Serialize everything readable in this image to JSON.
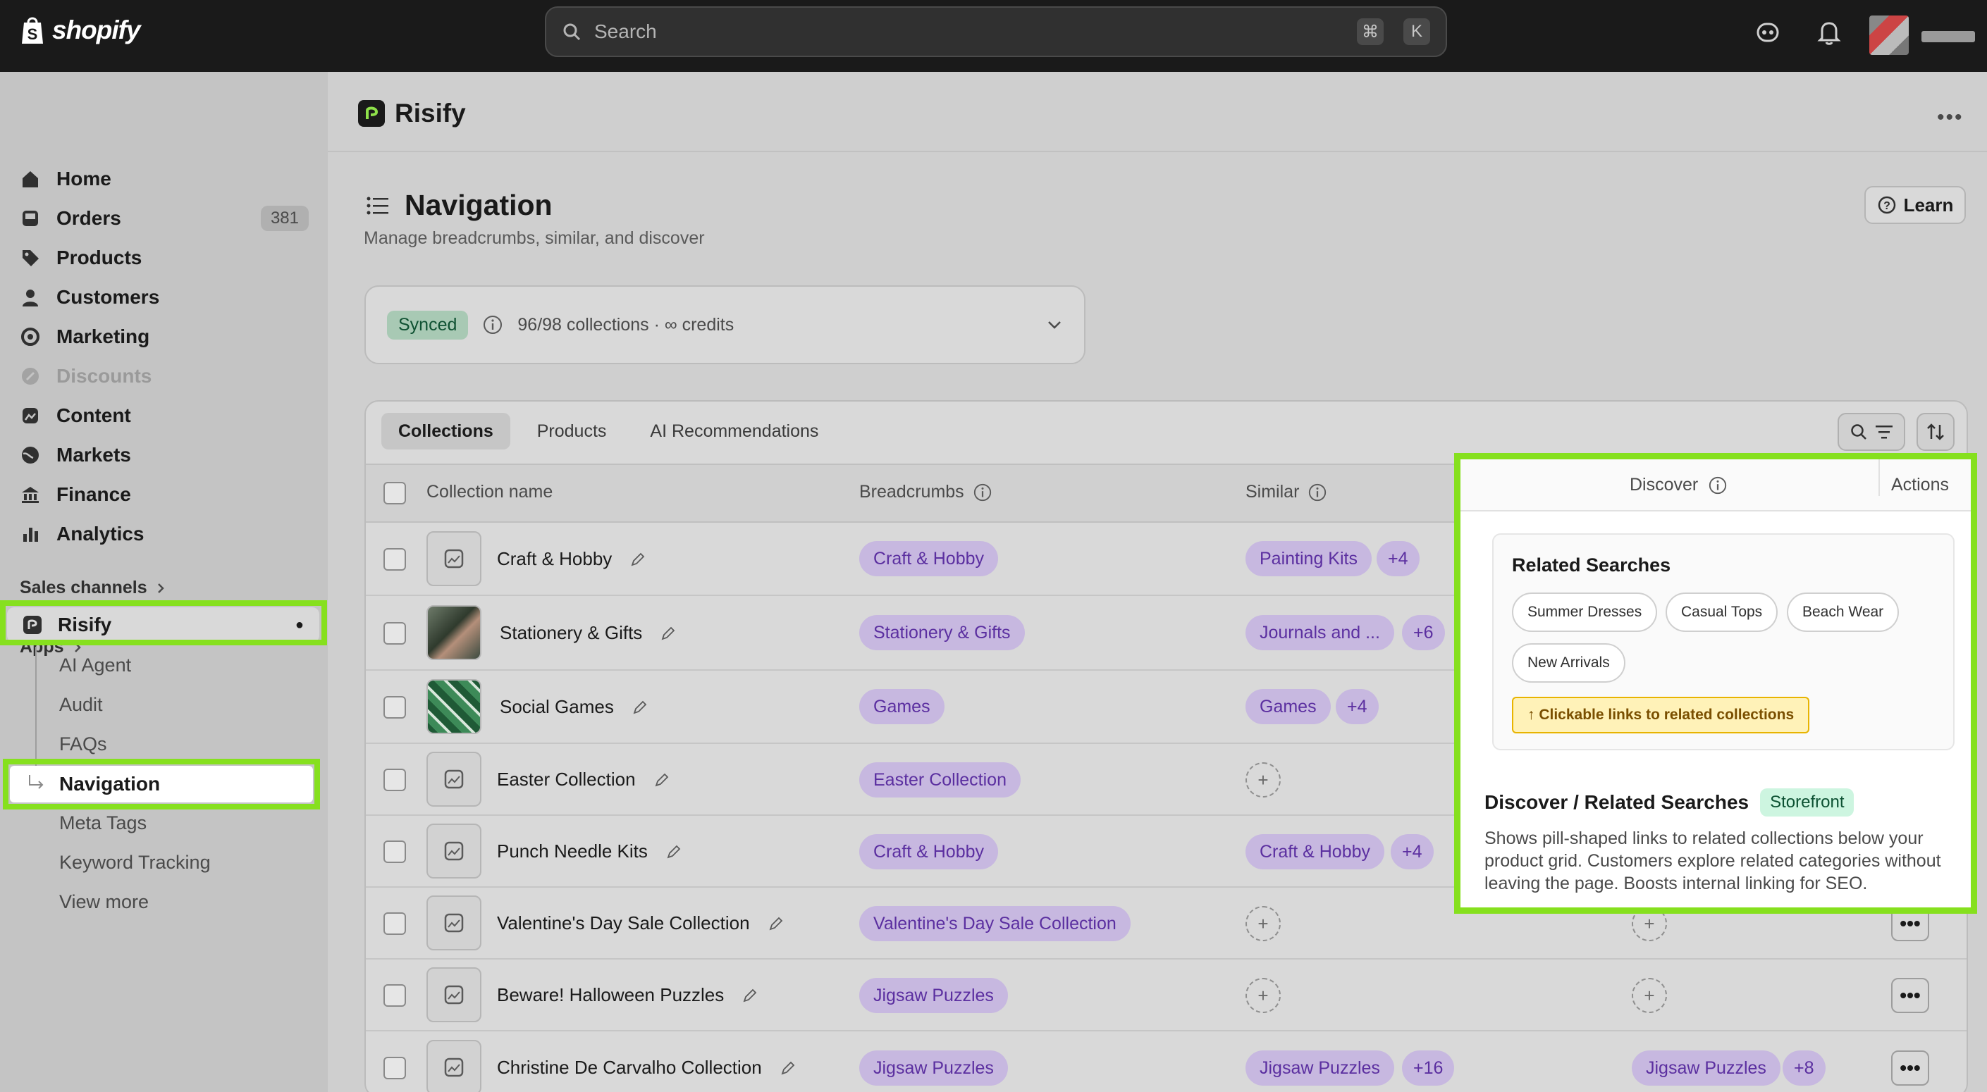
{
  "topbar": {
    "brand": "shopify",
    "search_placeholder": "Search",
    "shortcut_cmd": "⌘",
    "shortcut_key": "K"
  },
  "sidebar": {
    "items": [
      {
        "label": "Home",
        "icon": "home-icon"
      },
      {
        "label": "Orders",
        "icon": "inbox-icon",
        "count": "381"
      },
      {
        "label": "Products",
        "icon": "tag-icon"
      },
      {
        "label": "Customers",
        "icon": "person-icon"
      },
      {
        "label": "Marketing",
        "icon": "target-icon"
      },
      {
        "label": "Discounts",
        "icon": "discount-icon",
        "disabled": true
      },
      {
        "label": "Content",
        "icon": "content-icon"
      },
      {
        "label": "Markets",
        "icon": "globe-icon"
      },
      {
        "label": "Finance",
        "icon": "bank-icon"
      },
      {
        "label": "Analytics",
        "icon": "chart-icon"
      }
    ],
    "sales_channels": "Sales channels",
    "apps": "Apps",
    "app_name": "Risify",
    "app_items": [
      "AI Agent",
      "Audit",
      "FAQs",
      "Navigation",
      "Meta Tags",
      "Keyword Tracking",
      "View more"
    ]
  },
  "header": {
    "app_title": "Risify",
    "page_title": "Navigation",
    "page_subtitle": "Manage breadcrumbs, similar, and discover",
    "learn_label": "Learn"
  },
  "status": {
    "badge": "Synced",
    "text": "96/98 collections · ∞ credits"
  },
  "tabs": [
    "Collections",
    "Products",
    "AI Recommendations"
  ],
  "table": {
    "headers": {
      "name": "Collection name",
      "breadcrumbs": "Breadcrumbs",
      "similar": "Similar",
      "discover": "Discover",
      "actions": "Actions"
    },
    "rows": [
      {
        "name": "Craft & Hobby",
        "breadcrumb": "Craft & Hobby",
        "similar": "Painting Kits",
        "similar_more": "+4"
      },
      {
        "name": "Stationery & Gifts",
        "breadcrumb": "Stationery & Gifts",
        "similar": "Journals and ...",
        "similar_more": "+6"
      },
      {
        "name": "Social Games",
        "breadcrumb": "Games",
        "similar": "Games",
        "similar_more": "+4"
      },
      {
        "name": "Easter Collection",
        "breadcrumb": "Easter Collection"
      },
      {
        "name": "Punch Needle Kits",
        "breadcrumb": "Craft & Hobby",
        "similar": "Craft & Hobby",
        "similar_more": "+4"
      },
      {
        "name": "Valentine's Day Sale Collection",
        "breadcrumb": "Valentine's Day Sale Collection"
      },
      {
        "name": "Beware! Halloween Puzzles",
        "breadcrumb": "Jigsaw Puzzles"
      },
      {
        "name": "Christine De Carvalho Collection",
        "breadcrumb": "Jigsaw Puzzles",
        "similar": "Jigsaw Puzzles",
        "similar_more": "+16",
        "discover": "Jigsaw Puzzles",
        "discover_more": "+8"
      }
    ],
    "plus_glyph": "+",
    "dots_glyph": "•••"
  },
  "discover_panel": {
    "header": "Discover",
    "actions": "Actions",
    "demo_title": "Related Searches",
    "chips": [
      "Summer Dresses",
      "Casual Tops",
      "Beach Wear",
      "New Arrivals"
    ],
    "note": "↑ Clickable links to related collections",
    "title": "Discover / Related Searches",
    "badge": "Storefront",
    "description": "Shows pill-shaped links to related collections below your product grid. Customers explore related categories without leaving the page. Boosts internal linking for SEO."
  },
  "colors": {
    "highlight": "#86e01e",
    "tag_bg": "#c7b8e0",
    "tag_text": "#5b2fa0",
    "synced": "#0f5132"
  }
}
